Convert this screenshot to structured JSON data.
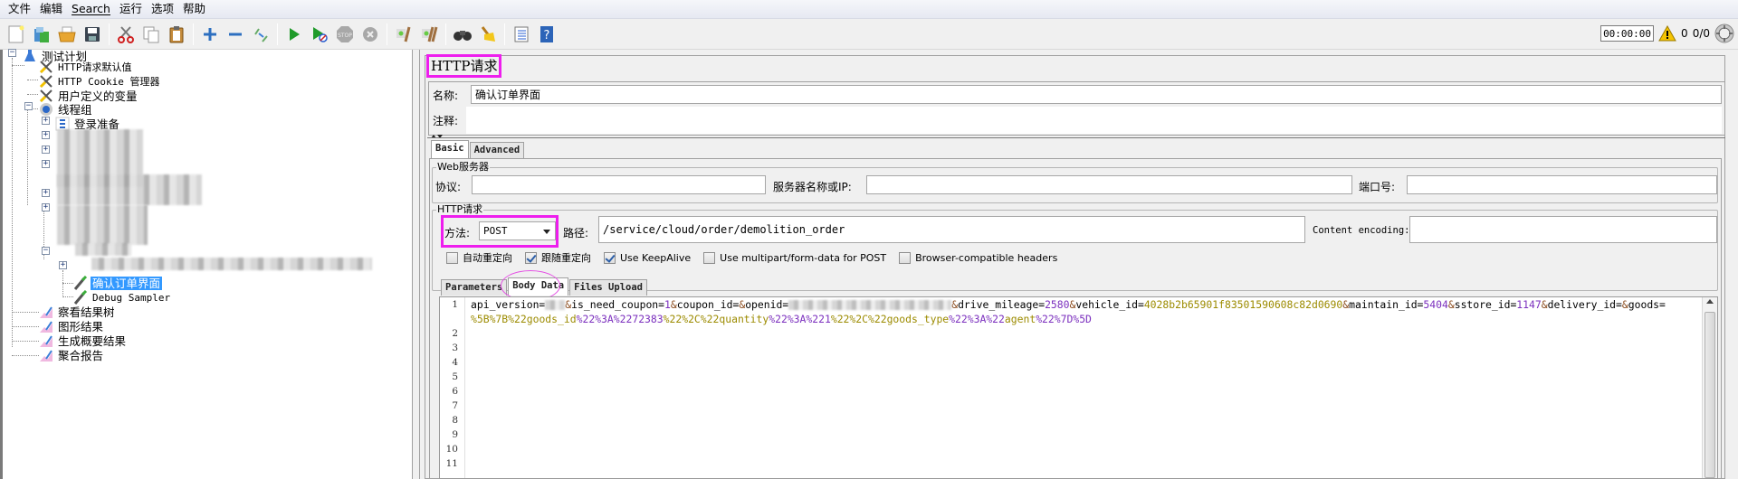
{
  "menu": {
    "items": [
      "文件",
      "编辑",
      "Search",
      "运行",
      "选项",
      "帮助"
    ]
  },
  "toolbar": {
    "buttons": [
      "new-icon",
      "templates-icon",
      "open-icon",
      "save-icon",
      "cut-icon",
      "copy-icon",
      "paste-icon",
      "expand-icon",
      "collapse-icon",
      "toggle-icon",
      "start-icon",
      "start-no-pauses-icon",
      "stop-icon",
      "shutdown-icon",
      "clear-icon",
      "clear-all-icon",
      "search-icon",
      "reset-search-icon",
      "function-helper-icon",
      "help-icon"
    ],
    "timer": "00:00:00",
    "warning_count": "0",
    "threads": "0/0",
    "remote_icon": "remote-engines-icon"
  },
  "tree": {
    "root": "测试计划",
    "items": [
      {
        "label": "HTTP请求默认值",
        "icon": "config-icon"
      },
      {
        "label": "HTTP Cookie 管理器",
        "icon": "config-icon"
      },
      {
        "label": "用户定义的变量",
        "icon": "config-icon"
      },
      {
        "label": "线程组",
        "icon": "thread-group-icon"
      },
      {
        "label": "登录准备",
        "icon": "controller-icon"
      },
      {
        "label": "确认订单界面",
        "icon": "sampler-icon",
        "selected": true
      },
      {
        "label": "Debug Sampler",
        "icon": "sampler-icon"
      },
      {
        "label": "察看结果树",
        "icon": "listener-icon"
      },
      {
        "label": "图形结果",
        "icon": "listener-icon"
      },
      {
        "label": "生成概要结果",
        "icon": "listener-icon"
      },
      {
        "label": "聚合报告",
        "icon": "listener-icon"
      }
    ]
  },
  "panel": {
    "title": "HTTP请求",
    "name_label": "名称:",
    "name_value": "确认订单界面",
    "comment_label": "注释:",
    "comment_value": "",
    "tabs": [
      "Basic",
      "Advanced"
    ],
    "active_tab": "Basic",
    "web_server": {
      "group_title": "Web服务器",
      "protocol_label": "协议:",
      "protocol_value": "",
      "server_label": "服务器名称或IP:",
      "server_value": "",
      "port_label": "端口号:",
      "port_value": ""
    },
    "http_request": {
      "group_title": "HTTP请求",
      "method_label": "方法:",
      "method_value": "POST",
      "path_label": "路径:",
      "path_value": "/service/cloud/order/demolition_order",
      "encoding_label": "Content encoding:",
      "encoding_value": "",
      "checkboxes": [
        {
          "label": "自动重定向",
          "checked": false
        },
        {
          "label": "跟随重定向",
          "checked": true
        },
        {
          "label": "Use KeepAlive",
          "checked": true
        },
        {
          "label": "Use multipart/form-data for POST",
          "checked": false
        },
        {
          "label": "Browser-compatible headers",
          "checked": false
        }
      ]
    },
    "body_tabs": [
      "Parameters",
      "Body Data",
      "Files Upload"
    ],
    "active_body_tab": "Body Data",
    "body": {
      "line_numbers": [
        "1",
        "2",
        "3",
        "4",
        "5",
        "6",
        "7",
        "8",
        "9",
        "10",
        "11"
      ],
      "segments_line1": [
        {
          "t": "api_version=",
          "c": "k"
        },
        {
          "t": "",
          "c": "blur",
          "w": 22
        },
        {
          "t": "&",
          "c": "amp"
        },
        {
          "t": "is_need_coupon=",
          "c": "k"
        },
        {
          "t": "1",
          "c": "v"
        },
        {
          "t": "&",
          "c": "amp"
        },
        {
          "t": "coupon_id=",
          "c": "k"
        },
        {
          "t": "&",
          "c": "amp"
        },
        {
          "t": "openid=",
          "c": "k"
        },
        {
          "t": "",
          "c": "blur",
          "w": 180
        },
        {
          "t": "&",
          "c": "amp"
        },
        {
          "t": "drive_mileage=",
          "c": "k"
        },
        {
          "t": "2580",
          "c": "v"
        },
        {
          "t": "&",
          "c": "amp"
        },
        {
          "t": "vehicle_id=",
          "c": "k"
        },
        {
          "t": "4028b2b65901f83501590608c82d0690",
          "c": "s"
        },
        {
          "t": "&",
          "c": "amp"
        },
        {
          "t": "maintain_id=",
          "c": "k"
        },
        {
          "t": "5404",
          "c": "v"
        },
        {
          "t": "&",
          "c": "amp"
        },
        {
          "t": "sstore_id=",
          "c": "k"
        },
        {
          "t": "1147",
          "c": "v"
        },
        {
          "t": "&",
          "c": "amp"
        },
        {
          "t": "delivery_id=",
          "c": "k"
        },
        {
          "t": "&",
          "c": "amp"
        },
        {
          "t": "goods=",
          "c": "k"
        }
      ],
      "segments_line1_wrap": [
        {
          "t": "%5B%7B%22",
          "c": "s"
        },
        {
          "t": "goods_id",
          "c": "s"
        },
        {
          "t": "%22%3A%22",
          "c": "v"
        },
        {
          "t": "72383",
          "c": "v"
        },
        {
          "t": "%22%2C%22",
          "c": "s"
        },
        {
          "t": "quantity",
          "c": "s"
        },
        {
          "t": "%22%3A%22",
          "c": "v"
        },
        {
          "t": "1",
          "c": "v"
        },
        {
          "t": "%22%2C%22",
          "c": "s"
        },
        {
          "t": "goods_type",
          "c": "s"
        },
        {
          "t": "%22%3A%22",
          "c": "v"
        },
        {
          "t": "agent",
          "c": "s"
        },
        {
          "t": "%22%7D%5D",
          "c": "v"
        }
      ]
    }
  }
}
